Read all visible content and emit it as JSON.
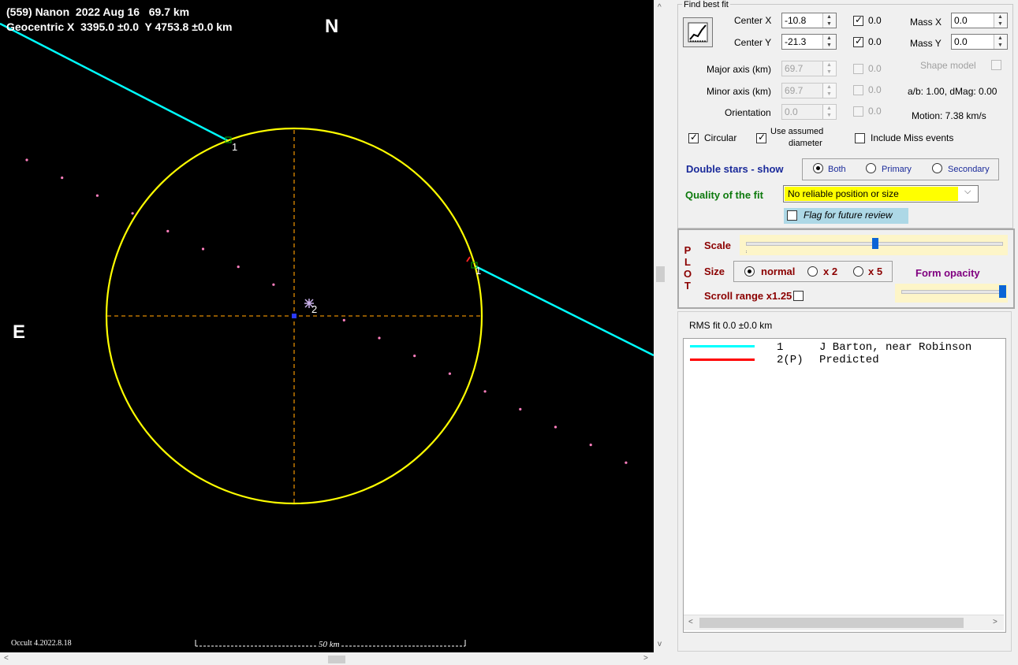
{
  "plot": {
    "title_line1": "(559) Nanon  2022 Aug 16   69.7 km",
    "title_line2": "Geocentric X  3395.0 ±0.0  Y 4753.8 ±0.0 km",
    "north_label": "N",
    "east_label": "E",
    "version": "Occult 4.2022.8.18",
    "scale_label": "50 km",
    "chord_label_1a": "1",
    "chord_label_1b": "1",
    "chord_label_2": "2",
    "ellipse_color": "#ffff00",
    "chord_color": "#00ffff"
  },
  "fit": {
    "group_title": "Find best fit",
    "button_icon": "chart-fit-icon",
    "center_x_label": "Center X",
    "center_x_value": "-10.8",
    "center_x_check": "0.0",
    "center_y_label": "Center Y",
    "center_y_value": "-21.3",
    "center_y_check": "0.0",
    "mass_x_label": "Mass X",
    "mass_x_value": "0.0",
    "mass_y_label": "Mass Y",
    "mass_y_value": "0.0",
    "major_label": "Major axis (km)",
    "major_value": "69.7",
    "major_check": "0.0",
    "minor_label": "Minor axis (km)",
    "minor_value": "69.7",
    "minor_check": "0.0",
    "orientation_label": "Orientation",
    "orientation_value": "0.0",
    "orientation_check": "0.0",
    "shape_model_label": "Shape model",
    "ab_text": "a/b: 1.00, dMag: 0.00",
    "motion_text": "Motion: 7.38 km/s",
    "circular_label": "Circular",
    "assumed_label_1": "Use assumed",
    "assumed_label_2": "diameter",
    "miss_label": "Include Miss events"
  },
  "double": {
    "label": "Double stars - show",
    "both": "Both",
    "primary": "Primary",
    "secondary": "Secondary"
  },
  "quality": {
    "label": "Quality of the fit",
    "value": "No reliable position or size",
    "flag_label": "Flag for future review"
  },
  "plotopts": {
    "side_label": [
      "P",
      "L",
      "O",
      "T"
    ],
    "scale_label": "Scale",
    "scale_level": 0.5,
    "size_label": "Size",
    "size_normal": "normal",
    "size_x2": "x 2",
    "size_x5": "x 5",
    "form_opacity_label": "Form opacity",
    "opacity_level": 1.0,
    "scroll_label": "Scroll range x1.25"
  },
  "rms": "RMS fit 0.0 ±0.0 km",
  "legend": [
    {
      "id": "1",
      "text": "J Barton, near Robinson",
      "color": "#00ffff"
    },
    {
      "id": "2(P)",
      "text": "Predicted",
      "color": "#ff0000"
    }
  ]
}
